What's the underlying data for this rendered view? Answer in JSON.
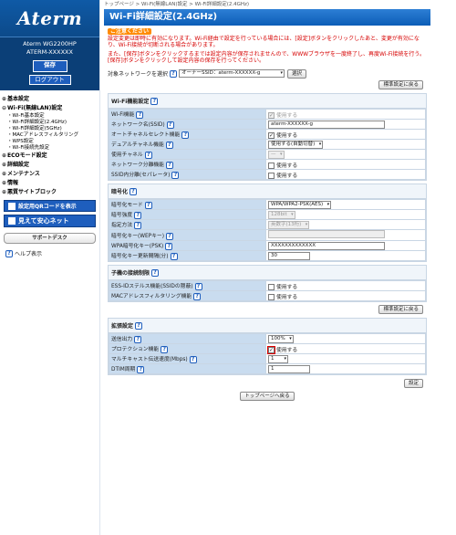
{
  "sidebar": {
    "logo": "Aterm",
    "model": "Aterm WG2200HP",
    "device_id": "ATERM-XXXXXX",
    "save_label": "保存",
    "logout_label": "ログアウト",
    "nav": [
      {
        "label": "基本設定",
        "open": false
      },
      {
        "label": "Wi-Fi(無線LAN)設定",
        "open": true
      }
    ],
    "sub_items": [
      "Wi-Fi基本設定",
      "Wi-Fi詳細設定(2.4GHz)",
      "Wi-Fi詳細設定(5GHz)",
      "MACアドレスフィルタリング",
      "WPS設定",
      "Wi-Fi接続先設定"
    ],
    "nav2": [
      "ECOモード設定",
      "詳細設定",
      "メンテナンス",
      "情報",
      "悪質サイトブロック"
    ],
    "qr_label": "設定用QRコードを表示",
    "safe_net_label": "見えて安心ネット",
    "support_label": "サポートデスク",
    "help_label": "ヘルプ表示"
  },
  "breadcrumb": "トップページ > Wi-Fi(無線LAN)設定 > Wi-Fi詳細設定(2.4GHz)",
  "title": "Wi-Fi詳細設定(2.4GHz)",
  "notice": {
    "tag": "ご注意ください",
    "line1": "設定変更は即時に有効になります。Wi-Fi経由で設定を行っている場合には、[設定]ボタンをクリックしたあと、変更が有効になり、Wi-Fi接続が切断される場合があります。",
    "line2": "また、[保存]ボタンをクリックするまでは設定内容が保存されませんので、WWWブラウザを一度終了し、再度Wi-Fi接続を行う。[保存]ボタンをクリックして設定内容の保存を行ってください。"
  },
  "target": {
    "label": "対象ネットワークを選択",
    "value": "オーナーSSID：aterm-XXXXXX-g",
    "select_btn": "選択"
  },
  "default_btn": "標準設定に戻る",
  "wifi_section": {
    "title": "Wi-Fi機能設定",
    "rows": [
      {
        "label": "Wi-Fi機能",
        "value": "使用する",
        "kind": "check-dis"
      },
      {
        "label": "ネットワーク名(SSID)",
        "value": "aterm-XXXXXX-g",
        "kind": "text"
      },
      {
        "label": "オートチャネルセレクト機能",
        "value": "使用する",
        "kind": "check"
      },
      {
        "label": "デュアルチャネル機能",
        "value": "使用する(自動切替)",
        "kind": "select"
      },
      {
        "label": "使用チャネル",
        "value": "—",
        "kind": "select-dis"
      },
      {
        "label": "ネットワーク分離機能",
        "value": "使用する",
        "kind": "check-empty"
      },
      {
        "label": "SSID内分離(セパレータ)",
        "value": "使用する",
        "kind": "check-empty"
      }
    ]
  },
  "enc_section": {
    "title": "暗号化",
    "rows": [
      {
        "label": "暗号化モード",
        "value": "WPA/WPA2-PSK(AES)",
        "kind": "select"
      },
      {
        "label": "暗号強度",
        "value": "128bit",
        "kind": "select-dis"
      },
      {
        "label": "指定方法",
        "value": "英数字(13桁)",
        "kind": "select-dis"
      },
      {
        "label": "暗号化キー(WEPキー)",
        "value": "",
        "kind": "text-dis"
      },
      {
        "label": "WPA暗号化キー(PSK)",
        "value": "XXXXXXXXXXXXX",
        "kind": "text"
      },
      {
        "label": "暗号化キー更新間隔(分)",
        "value": "30",
        "kind": "text-small"
      }
    ]
  },
  "child_section": {
    "title": "子機の接続制限",
    "rows": [
      {
        "label": "ESS-IDステルス機能(SSIDの隠蔽)",
        "value": "使用する",
        "kind": "check-empty"
      },
      {
        "label": "MACアドレスフィルタリング機能",
        "value": "使用する",
        "kind": "check-empty"
      }
    ]
  },
  "ext_section": {
    "title": "拡張設定",
    "rows": [
      {
        "label": "送信出力",
        "value": "100%",
        "kind": "select"
      },
      {
        "label": "プロテクション機能",
        "value": "使用する",
        "kind": "check-hl"
      },
      {
        "label": "マルチキャスト伝送速度(Mbps)",
        "value": "1",
        "kind": "select"
      },
      {
        "label": "DTIM周期",
        "value": "1",
        "kind": "text-small"
      }
    ]
  },
  "set_btn": "設定",
  "top_btn": "トップページへ戻る"
}
